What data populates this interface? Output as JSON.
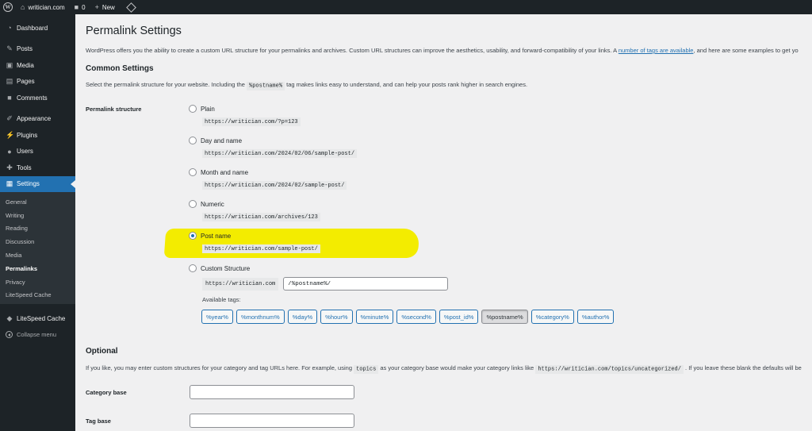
{
  "adminbar": {
    "site_name": "writician.com",
    "comments_count": "0",
    "new_label": "New"
  },
  "sidebar": {
    "items": [
      {
        "label": "Dashboard",
        "icon": "dashboard-icon"
      },
      {
        "label": "Posts",
        "icon": "pin-icon"
      },
      {
        "label": "Media",
        "icon": "media-icon"
      },
      {
        "label": "Pages",
        "icon": "pages-icon"
      },
      {
        "label": "Comments",
        "icon": "comment-icon"
      },
      {
        "label": "Appearance",
        "icon": "brush-icon"
      },
      {
        "label": "Plugins",
        "icon": "plug-icon"
      },
      {
        "label": "Users",
        "icon": "users-icon"
      },
      {
        "label": "Tools",
        "icon": "wrench-icon"
      },
      {
        "label": "Settings",
        "icon": "settings-icon"
      }
    ],
    "submenu": [
      "General",
      "Writing",
      "Reading",
      "Discussion",
      "Media",
      "Permalinks",
      "Privacy",
      "LiteSpeed Cache"
    ],
    "litespeed": "LiteSpeed Cache",
    "collapse": "Collapse menu"
  },
  "page": {
    "title": "Permalink Settings",
    "intro_before": "WordPress offers you the ability to create a custom URL structure for your permalinks and archives. Custom URL structures can improve the aesthetics, usability, and forward-compatibility of your links. A ",
    "intro_link": "number of tags are available",
    "intro_after": ", and here are some examples to get yo",
    "common_heading": "Common Settings",
    "common_desc_before": "Select the permalink structure for your website. Including the ",
    "common_desc_code": "%postname%",
    "common_desc_after": " tag makes links easy to understand, and can help your posts rank higher in search engines.",
    "structure_label": "Permalink structure"
  },
  "options": [
    {
      "label": "Plain",
      "url": "https://writician.com/?p=123",
      "checked": false
    },
    {
      "label": "Day and name",
      "url": "https://writician.com/2024/02/06/sample-post/",
      "checked": false
    },
    {
      "label": "Month and name",
      "url": "https://writician.com/2024/02/sample-post/",
      "checked": false
    },
    {
      "label": "Numeric",
      "url": "https://writician.com/archives/123",
      "checked": false
    },
    {
      "label": "Post name",
      "url": "https://writician.com/sample-post/",
      "checked": true
    }
  ],
  "custom": {
    "label": "Custom Structure",
    "prefix": "https://writician.com",
    "value": "/%postname%/",
    "available_tags_label": "Available tags:",
    "tags": [
      "%year%",
      "%monthnum%",
      "%day%",
      "%hour%",
      "%minute%",
      "%second%",
      "%post_id%",
      "%postname%",
      "%category%",
      "%author%"
    ],
    "active_tag": "%postname%"
  },
  "optional": {
    "heading": "Optional",
    "desc_before": "If you like, you may enter custom structures for your category and tag URLs here. For example, using ",
    "desc_code1": "topics",
    "desc_mid": " as your category base would make your category links like ",
    "desc_code2": "https://writician.com/topics/uncategorized/",
    "desc_after": " . If you leave these blank the defaults will be",
    "category_base_label": "Category base",
    "tag_base_label": "Tag base"
  },
  "colors": {
    "accent": "#2271b1",
    "sidebar": "#1d2327",
    "highlight": "#f3ec00"
  }
}
